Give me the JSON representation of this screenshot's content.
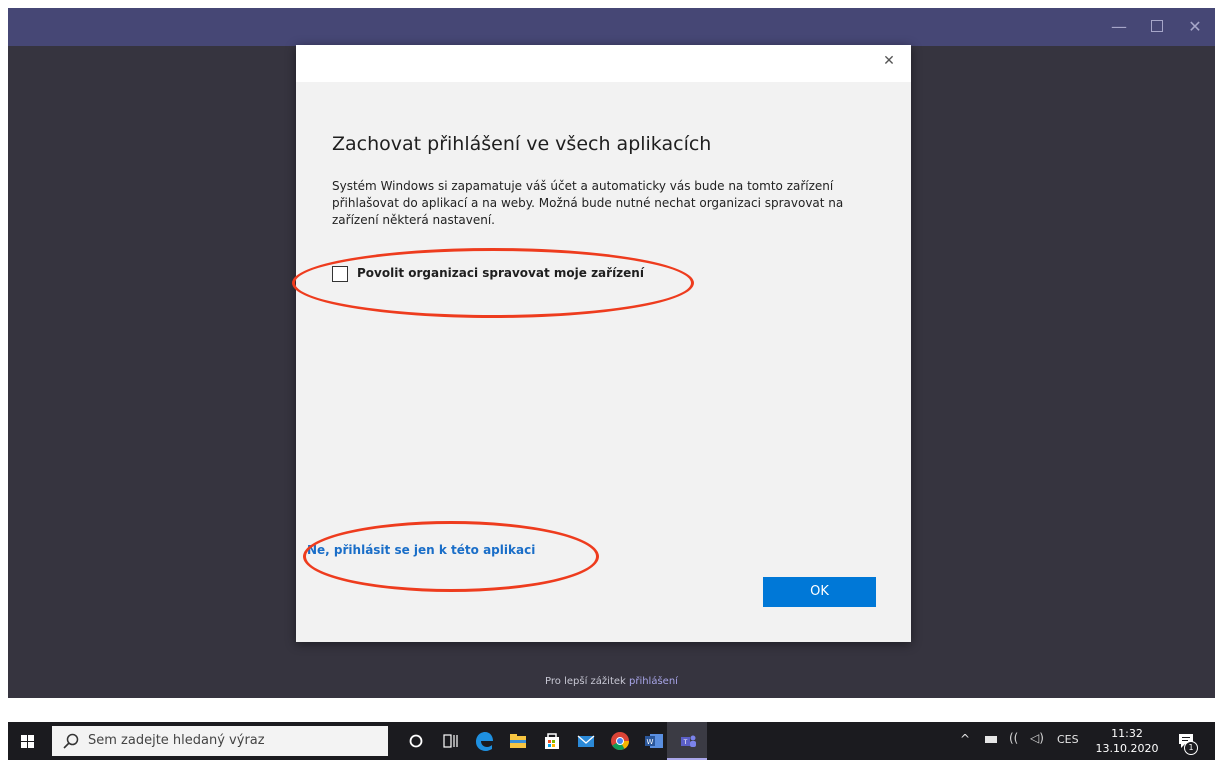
{
  "window": {
    "minimize_glyph": "—",
    "close_glyph": "✕"
  },
  "footer": {
    "text": "Pro lepší zážitek ",
    "link": "přihlášení"
  },
  "dialog": {
    "close_glyph": "✕",
    "title": "Zachovat přihlášení ve všech aplikacích",
    "description": "Systém Windows si zapamatuje váš účet a automaticky vás bude na tomto zařízení přihlašovat do aplikací a na weby. Možná bude nutné nechat organizaci spravovat na zařízení některá nastavení.",
    "checkbox_label": "Povolit organizaci spravovat moje zařízení",
    "checkbox_checked": false,
    "only_this_app_link": "Ne, přihlásit se jen k této aplikaci",
    "ok_label": "OK",
    "accent_color": "#0078d7",
    "annotation_color": "#ee3c1e"
  },
  "taskbar": {
    "search_placeholder": "Sem zadejte hledaný výraz",
    "apps": [
      {
        "icon": "cortana-icon"
      },
      {
        "icon": "task-view-icon"
      },
      {
        "icon": "edge-icon"
      },
      {
        "icon": "file-explorer-icon"
      },
      {
        "icon": "store-icon"
      },
      {
        "icon": "mail-icon"
      },
      {
        "icon": "chrome-icon"
      },
      {
        "icon": "word-icon"
      },
      {
        "icon": "teams-icon"
      }
    ],
    "tray": {
      "chevron": "^",
      "wifi_glyph": "((",
      "volume_glyph": "◁)",
      "language": "CES",
      "time": "11:32",
      "date": "13.10.2020",
      "notification_count": "1"
    }
  }
}
